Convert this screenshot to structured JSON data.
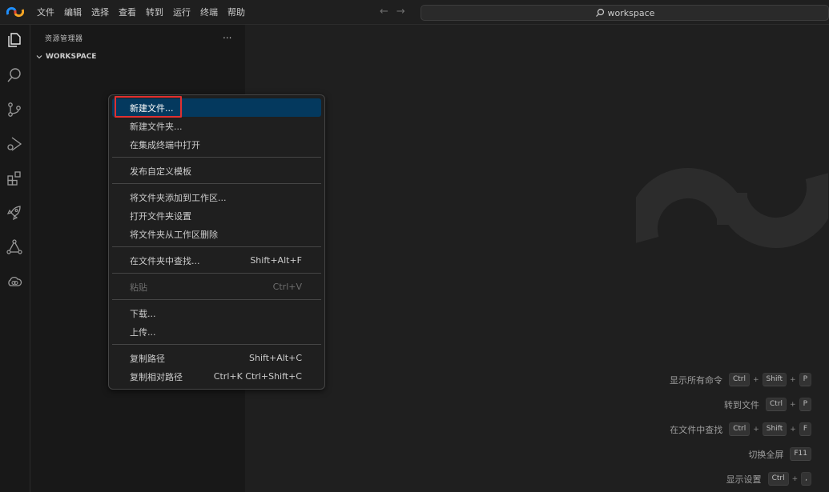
{
  "colors": {
    "accent_orange": "#f5a524",
    "accent_red": "#e8452c",
    "accent_blue": "#1f8fff",
    "active_bg": "#04395e",
    "highlight": "#e03030"
  },
  "menubar": [
    "文件",
    "编辑",
    "选择",
    "查看",
    "转到",
    "运行",
    "终端",
    "帮助"
  ],
  "search": {
    "text": "workspace",
    "icon": "search-icon"
  },
  "activitybar": [
    "explorer-icon",
    "search-icon",
    "source-control-icon",
    "run-debug-icon",
    "extensions-icon",
    "rocket-icon",
    "graph-icon",
    "cloud-icon"
  ],
  "sidebar": {
    "title": "资源管理器",
    "more": "...",
    "workspace": "WORKSPACE"
  },
  "context_menu": {
    "items": [
      {
        "label": "新建文件...",
        "key": "",
        "state": "active"
      },
      {
        "label": "新建文件夹...",
        "key": ""
      },
      {
        "label": "在集成终端中打开",
        "key": ""
      },
      {
        "sep": true
      },
      {
        "label": "发布自定义模板",
        "key": ""
      },
      {
        "sep": true
      },
      {
        "label": "将文件夹添加到工作区...",
        "key": ""
      },
      {
        "label": "打开文件夹设置",
        "key": ""
      },
      {
        "label": "将文件夹从工作区删除",
        "key": ""
      },
      {
        "sep": true
      },
      {
        "label": "在文件夹中查找...",
        "key": "Shift+Alt+F"
      },
      {
        "sep": true
      },
      {
        "label": "粘贴",
        "key": "Ctrl+V",
        "state": "disabled"
      },
      {
        "sep": true
      },
      {
        "label": "下载...",
        "key": ""
      },
      {
        "label": "上传...",
        "key": ""
      },
      {
        "sep": true
      },
      {
        "label": "复制路径",
        "key": "Shift+Alt+C"
      },
      {
        "label": "复制相对路径",
        "key": "Ctrl+K Ctrl+Shift+C"
      }
    ]
  },
  "shortcuts": [
    {
      "label": "显示所有命令",
      "keys": [
        "Ctrl",
        "Shift",
        "P"
      ]
    },
    {
      "label": "转到文件",
      "keys": [
        "Ctrl",
        "P"
      ]
    },
    {
      "label": "在文件中查找",
      "keys": [
        "Ctrl",
        "Shift",
        "F"
      ]
    },
    {
      "label": "切换全屏",
      "keys": [
        "F11"
      ]
    },
    {
      "label": "显示设置",
      "keys": [
        "Ctrl",
        ","
      ]
    }
  ]
}
